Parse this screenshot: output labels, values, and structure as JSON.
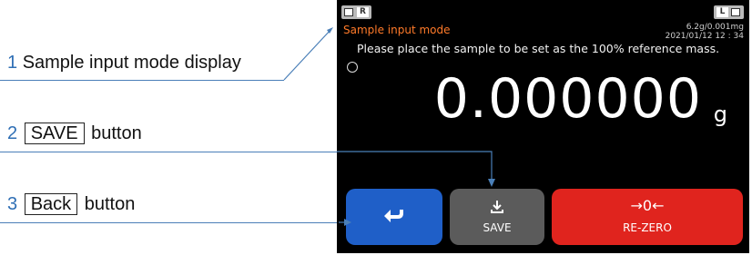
{
  "callouts": [
    {
      "num": "1",
      "text": "Sample input mode display",
      "boxed": "",
      "suffix": ""
    },
    {
      "num": "2",
      "text": "",
      "boxed": "SAVE",
      "suffix": "button"
    },
    {
      "num": "3",
      "text": "",
      "boxed": "Back",
      "suffix": "button"
    }
  ],
  "screen": {
    "left_indicator": "R",
    "right_indicator": "L",
    "mode_title": "Sample input mode",
    "capacity": "6.2g/0.001mg",
    "datetime": "2021/01/12   12 : 34",
    "message": "Please place the sample to be set as the 100% reference mass.",
    "reading": "0.000000",
    "unit": "g"
  },
  "buttons": {
    "back": {
      "glyph": "return-arrow-icon"
    },
    "save": {
      "label": "SAVE",
      "glyph": "download-icon"
    },
    "rezero": {
      "label": "RE-ZERO",
      "glyph_text": "→0←"
    }
  },
  "colors": {
    "callout_number": "#2f6fb5",
    "leader_line": "#4a7fb8",
    "mode_title": "#ff7a29",
    "back_button": "#1f5fc8",
    "save_button": "#5b5b5b",
    "rezero_button": "#e0241e"
  }
}
